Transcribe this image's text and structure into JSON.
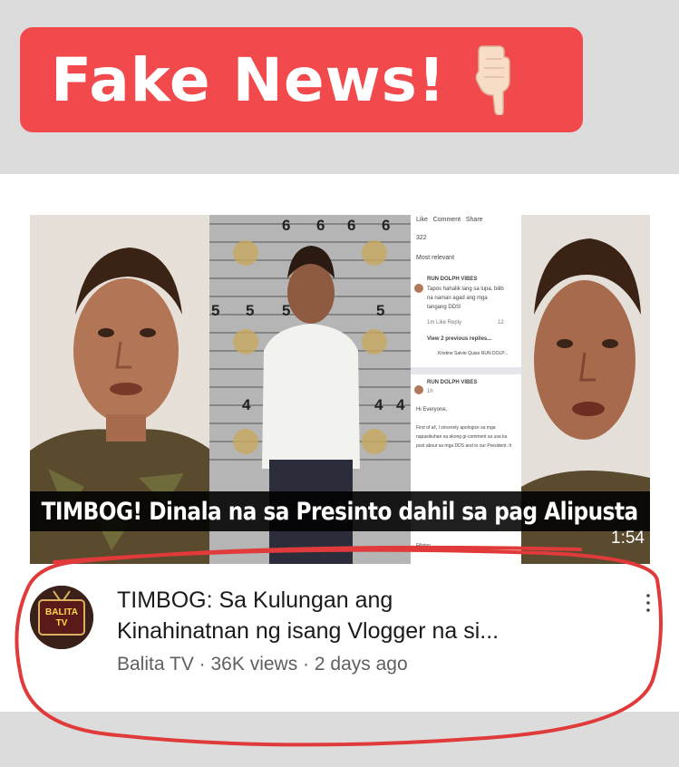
{
  "banner": {
    "text": "Fake News!",
    "emoji": "pointing-down-hand-icon",
    "color": "#f2494c"
  },
  "video": {
    "caption": "TIMBOG! Dinala na sa Presinto dahil sa pag Alipusta",
    "duration": "1:54",
    "title_line1": "TIMBOG: Sa Kulungan ang",
    "title_line2": "Kinahinatnan ng isang Vlogger na si...",
    "channel": "Balita TV",
    "views": "36K views",
    "age": "2 days ago",
    "separator": " · ",
    "channel_icon_text_1": "BALITA",
    "channel_icon_text_2": "TV"
  },
  "fb_mock": {
    "like": "Like",
    "comment": "Comment",
    "share": "Share",
    "count": "322",
    "relevant": "Most relevant",
    "author1": "RUN DOLPH VIBES",
    "comment1_l1": "Tapos hahalik lang sa lupa, bilib",
    "comment1_l2": "na naman agad ang mga",
    "comment1_l3": "tangang DDS!",
    "reply_meta": "1m  Like  Reply",
    "reply_count": "12",
    "view_replies": "View 2 previous replies...",
    "replier": "Kristine Salvie Quiao RUN DOLP...",
    "author2": "RUN DOLPH VIBES",
    "post_time": "1h",
    "greeting": "Hi Everyone,",
    "post_l1": "First of all, I sincerely apologize sa mga",
    "post_l2": "napasikuhan sa akong gi-comment sa usa ka",
    "post_l3": "post about sa mga DDS and to our President. It",
    "post_l4": "Filipino."
  },
  "ruler_numbers": [
    "6",
    "6",
    "6",
    "6",
    "5",
    "5",
    "5",
    "5",
    "4",
    "4",
    "4"
  ]
}
